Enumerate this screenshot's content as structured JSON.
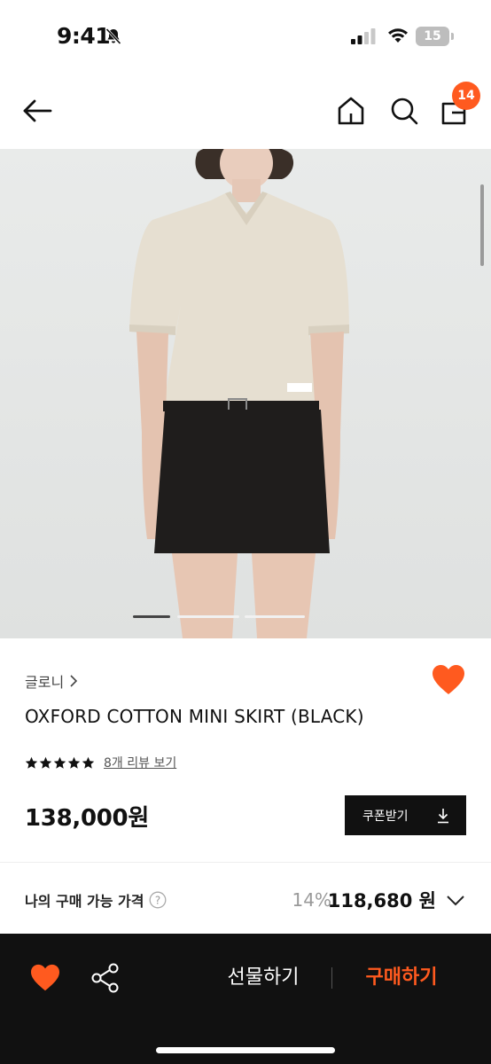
{
  "status_bar": {
    "time": "9:41",
    "battery": "15"
  },
  "nav": {
    "cart_count": "14"
  },
  "product": {
    "brand": "글로니",
    "title": "OXFORD COTTON MINI SKIRT (BLACK)",
    "review_link": "8개 리뷰 보기",
    "price": "138,000원",
    "coupon_label": "쿠폰받기"
  },
  "my_price": {
    "label": "나의 구매 가능 가격",
    "discount": "14%",
    "price": "118,680 원"
  },
  "bottom_bar": {
    "gift_label": "선물하기",
    "buy_label": "구매하기"
  },
  "colors": {
    "accent": "#ff5a1f",
    "dark": "#111111"
  },
  "icons": [
    "back-arrow-icon",
    "home-icon",
    "search-icon",
    "cart-icon",
    "heart-icon",
    "star-icon",
    "download-icon",
    "help-icon",
    "chevron-down-icon",
    "share-icon",
    "bell-off-icon",
    "signal-icon",
    "wifi-icon"
  ]
}
